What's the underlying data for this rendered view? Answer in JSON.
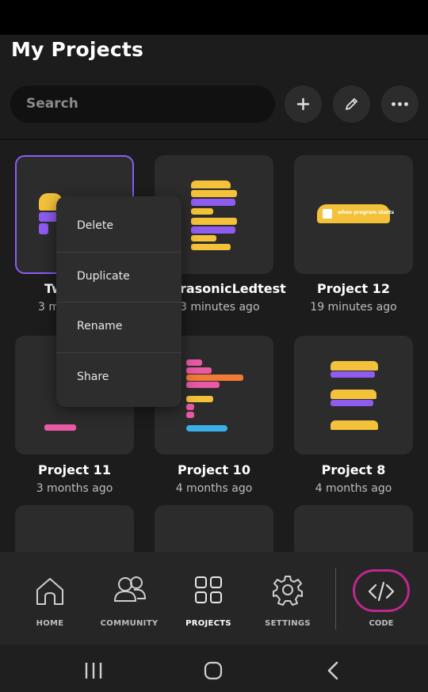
{
  "header": {
    "title": "My Projects"
  },
  "search": {
    "placeholder": "Search"
  },
  "toolbar": {
    "add_icon": "plus-icon",
    "edit_icon": "pencil-icon",
    "more_icon": "more-horizontal-icon"
  },
  "projects": [
    {
      "name": "Tw",
      "time": "3 m"
    },
    {
      "name": "rasonicLedtest",
      "time": "3 minutes ago"
    },
    {
      "name": "Project 12",
      "time": "19 minutes ago"
    },
    {
      "name": "Project 11",
      "time": "3 months ago"
    },
    {
      "name": "Project 10",
      "time": "4 months ago"
    },
    {
      "name": "Project 8",
      "time": "4 months ago"
    }
  ],
  "preview": {
    "when_program_starts": "when program starts"
  },
  "context_menu": {
    "items": [
      "Delete",
      "Duplicate",
      "Rename",
      "Share"
    ]
  },
  "bottom_nav": {
    "items": [
      {
        "label": "HOME",
        "icon": "home-icon"
      },
      {
        "label": "COMMUNITY",
        "icon": "community-icon"
      },
      {
        "label": "PROJECTS",
        "icon": "grid-icon",
        "active": true
      },
      {
        "label": "SETTINGS",
        "icon": "gear-icon"
      },
      {
        "label": "CODE",
        "icon": "code-icon"
      }
    ]
  },
  "colors": {
    "accent": "#8b5cf6",
    "code_ring": "#c0268f",
    "block_yellow": "#f3c23a"
  }
}
